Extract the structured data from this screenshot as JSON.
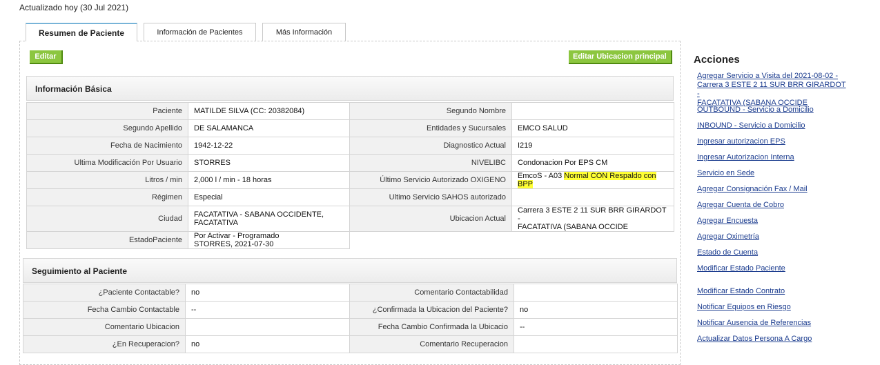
{
  "header": {
    "updated_text": "Actualizado hoy (30 Jul 2021)"
  },
  "tabs": [
    {
      "label": "Resumen de Paciente"
    },
    {
      "label": "Información de Pacientes"
    },
    {
      "label": "Más Información"
    }
  ],
  "buttons": {
    "edit": "Editar",
    "edit_location": "Editar Ubicacion principal"
  },
  "basic_info": {
    "title": "Información Básica",
    "rows": [
      {
        "l1": "Paciente",
        "v1": "MATILDE SILVA (CC: 20382084)",
        "l2": "Segundo Nombre",
        "v2": ""
      },
      {
        "l1": "Segundo Apellido",
        "v1": "DE SALAMANCA",
        "l2": "Entidades y Sucursales",
        "v2": "EMCO SALUD"
      },
      {
        "l1": "Fecha de Nacimiento",
        "v1": "1942-12-22",
        "l2": "Diagnostico Actual",
        "v2": "I219"
      },
      {
        "l1": "Ultima Modificación Por Usuario",
        "v1": "STORRES",
        "l2": "NIVELIBC",
        "v2": "Condonacion Por EPS CM"
      },
      {
        "l1": "Litros / min",
        "v1": "2,000 l / min - 18 horas",
        "l2": "Último Servicio Autorizado OXIGENO",
        "v2a": "EmcoS - A03 ",
        "v2b": "Normal CON Respaldo con BPP"
      },
      {
        "l1": "Régimen",
        "v1": "Especial",
        "l2": "Ultimo Servicio SAHOS autorizado",
        "v2": ""
      },
      {
        "l1": "Ciudad",
        "v1a": "FACATATIVA - SABANA OCCIDENTE,",
        "v1b": "FACATATIVA",
        "l2": "Ubicacion Actual",
        "v2a": "Carrera 3 ESTE 2 11 SUR BRR GIRARDOT -",
        "v2b": "FACATATIVA (SABANA OCCIDE"
      },
      {
        "l1": "EstadoPaciente",
        "v1a": "Por Activar - Programado",
        "v1b": "STORRES, 2021-07-30"
      }
    ]
  },
  "follow_up": {
    "title": "Seguimiento al Paciente",
    "rows": [
      {
        "l1": "¿Paciente Contactable?",
        "v1": "no",
        "l2": "Comentario Contactabilidad",
        "v2": ""
      },
      {
        "l1": "Fecha Cambio Contactable",
        "v1": "--",
        "l2": "¿Confirmada la Ubicacion del Paciente?",
        "v2": "no"
      },
      {
        "l1": "Comentario Ubicacion",
        "v1": "",
        "l2": "Fecha Cambio Confirmada la Ubicacio",
        "v2": "--"
      },
      {
        "l1": "¿En Recuperacion?",
        "v1": "no",
        "l2": "Comentario Recuperacion",
        "v2": ""
      }
    ]
  },
  "actions": {
    "title": "Acciones",
    "items": [
      {
        "label_a": "Agregar Servicio a Visita del 2021-08-02 -",
        "label_b": "Carrera 3 ESTE 2 11 SUR BRR GIRARDOT -",
        "label_c": "FACATATIVA (SABANA OCCIDE"
      },
      {
        "label": "OUTBOUND - Servicio a Domicilio"
      },
      {
        "label": "INBOUND - Servicio a Domicilio"
      },
      {
        "label": "Ingresar autorizacion EPS"
      },
      {
        "label": "Ingresar Autorizacion Interna"
      },
      {
        "label": "Servicio en Sede"
      },
      {
        "label": "Agregar Consignación Fax / Mail"
      },
      {
        "label": "Agregar Cuenta de Cobro"
      },
      {
        "label": "Agregar Encuesta"
      },
      {
        "label": "Agregar Oximetría"
      },
      {
        "label": "Estado de Cuenta"
      },
      {
        "label": "Modificar Estado Paciente"
      },
      {
        "label": "Modificar Estado Contrato"
      },
      {
        "label": "Notificar Equipos en Riesgo"
      },
      {
        "label": "Notificar Ausencia de Referencias"
      },
      {
        "label": "Actualizar Datos Persona A Cargo"
      }
    ]
  }
}
